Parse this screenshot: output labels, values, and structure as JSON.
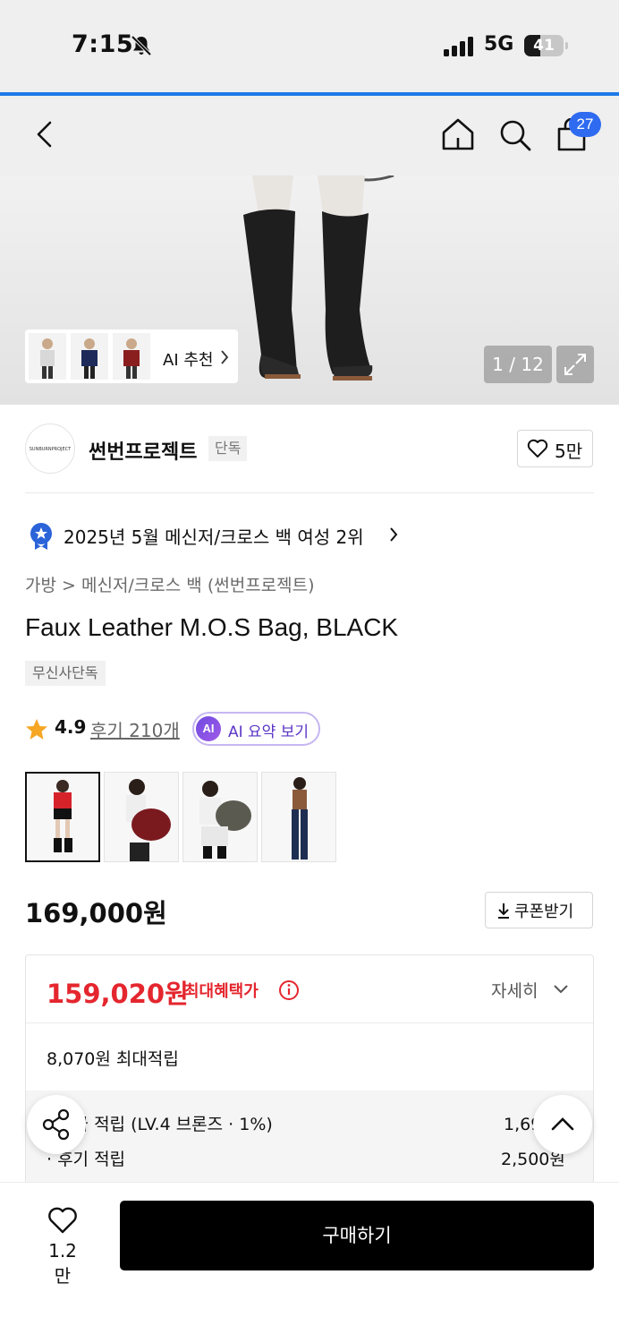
{
  "status_bar": {
    "time": "7:15",
    "network": "5G",
    "battery_level": "41",
    "battery_fraction": 0.41
  },
  "nav": {
    "back_icon": "chevron-left-icon",
    "home_icon": "home-icon",
    "search_icon": "search-icon",
    "cart_icon": "shopping-bag-icon",
    "cart_count": "27"
  },
  "gallery": {
    "ai_recommend_label": "AI 추천",
    "counter": "1 / 12",
    "expand_icon": "expand-icon"
  },
  "brand": {
    "logo_text": "SUNBURNPROJECT",
    "name": "썬번프로젝트",
    "tag": "단독",
    "likes": "5만"
  },
  "ranking": {
    "text": "2025년 5월 메신저/크로스 백 여성 2위"
  },
  "breadcrumb": {
    "category": "가방",
    "subcategory": "메신저/크로스 백 (썬번프로젝트)"
  },
  "product": {
    "title": "Faux Leather M.O.S Bag, BLACK",
    "exclusive_tag": "무신사단독",
    "rating": "4.9",
    "reviews": "후기 210개",
    "ai_badge": "AI",
    "ai_summary": "AI 요약 보기"
  },
  "pricing": {
    "price": "169,000원",
    "coupon_label": "쿠폰받기",
    "max_benefit_price": "159,020원",
    "max_benefit_label": "최대혜택가",
    "detail_label": "자세히",
    "max_points": "8,070원 최대적립",
    "points_rows": [
      {
        "label": "· 등급 적립 (LV.4 브론즈 · 1%)",
        "value": "1,690원"
      },
      {
        "label": "· 후기 적립",
        "value": "2,500원"
      }
    ]
  },
  "bottom_bar": {
    "wish_count": "1.2만",
    "buy_label": "구매하기"
  },
  "colors": {
    "accent_blue": "#1f7ae8",
    "badge_blue": "#2f6bf0",
    "sale_red": "#e4262e",
    "ai_purple": "#5b34c7"
  }
}
